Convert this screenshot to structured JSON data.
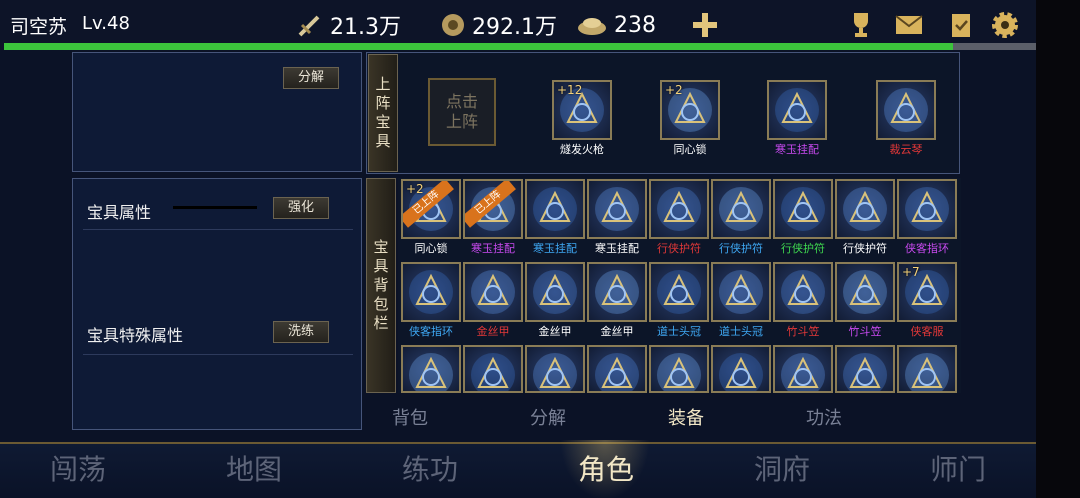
{
  "player": {
    "name": "司空苏",
    "level": "Lv.48"
  },
  "stats": {
    "power": "21.3万",
    "coins": "292.1万",
    "ingots": "238"
  },
  "xp": {
    "progress": 0.92
  },
  "left_panel": {
    "decompose_button": "分解",
    "attr_title": "宝具属性",
    "enhance_button": "强化",
    "special_title": "宝具特殊属性",
    "refine_button": "洗练"
  },
  "equipped": {
    "section_label": "上阵宝具",
    "empty_slot_label": "点击上阵",
    "items": [
      {
        "name": "燧发火枪",
        "level": "+12",
        "color": "#ffffff"
      },
      {
        "name": "同心锁",
        "level": "+2",
        "color": "#ffffff"
      },
      {
        "name": "寒玉挂配",
        "level": "",
        "color": "#c94af0"
      },
      {
        "name": "裁云琴",
        "level": "",
        "color": "#e23838"
      }
    ]
  },
  "backpack": {
    "section_label": "宝具背包栏",
    "equipped_tag": "已上阵",
    "row1": [
      {
        "name": "同心锁",
        "level": "+2",
        "tagged": true,
        "color": "#ffffff"
      },
      {
        "name": "寒玉挂配",
        "level": "",
        "tagged": true,
        "color": "#c94af0"
      },
      {
        "name": "寒玉挂配",
        "level": "",
        "tagged": false,
        "color": "#3fa9f5"
      },
      {
        "name": "寒玉挂配",
        "level": "",
        "tagged": false,
        "color": "#ffffff"
      },
      {
        "name": "行侠护符",
        "level": "",
        "tagged": false,
        "color": "#e23838"
      },
      {
        "name": "行侠护符",
        "level": "",
        "tagged": false,
        "color": "#3fa9f5"
      },
      {
        "name": "行侠护符",
        "level": "",
        "tagged": false,
        "color": "#3fd94f"
      },
      {
        "name": "行侠护符",
        "level": "",
        "tagged": false,
        "color": "#ffffff"
      },
      {
        "name": "侠客指环",
        "level": "",
        "tagged": false,
        "color": "#c94af0"
      }
    ],
    "row2": [
      {
        "name": "侠客指环",
        "level": "",
        "tagged": false,
        "color": "#3fa9f5"
      },
      {
        "name": "金丝甲",
        "level": "",
        "tagged": false,
        "color": "#e23838"
      },
      {
        "name": "金丝甲",
        "level": "",
        "tagged": false,
        "color": "#ffffff"
      },
      {
        "name": "金丝甲",
        "level": "",
        "tagged": false,
        "color": "#ffffff"
      },
      {
        "name": "道士头冠",
        "level": "",
        "tagged": false,
        "color": "#3fa9f5"
      },
      {
        "name": "道士头冠",
        "level": "",
        "tagged": false,
        "color": "#3fa9f5"
      },
      {
        "name": "竹斗笠",
        "level": "",
        "tagged": false,
        "color": "#e23838"
      },
      {
        "name": "竹斗笠",
        "level": "",
        "tagged": false,
        "color": "#c94af0"
      },
      {
        "name": "侠客服",
        "level": "+7",
        "tagged": false,
        "color": "#e23838"
      }
    ]
  },
  "sub_tabs": [
    "背包",
    "分解",
    "装备",
    "功法"
  ],
  "sub_tab_active": "装备",
  "nav": [
    "闯荡",
    "地图",
    "练功",
    "角色",
    "洞府",
    "师门"
  ],
  "nav_active": "角色"
}
